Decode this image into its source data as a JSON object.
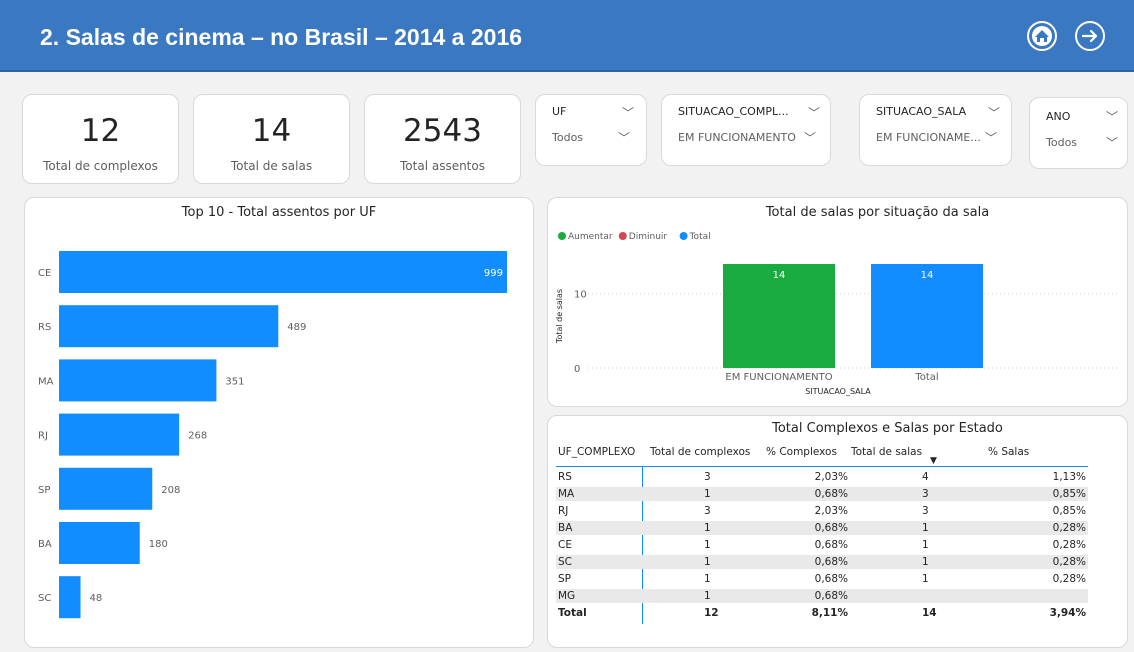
{
  "header": {
    "title": "2. Salas de cinema – no Brasil – 2014 a 2016",
    "home_icon": "home-icon",
    "next_icon": "arrow-right-icon"
  },
  "kpis": [
    {
      "value": "12",
      "label": "Total de complexos"
    },
    {
      "value": "14",
      "label": "Total de salas"
    },
    {
      "value": "2543",
      "label": "Total assentos"
    }
  ],
  "slicers": [
    {
      "title": "UF",
      "value": "Todos"
    },
    {
      "title": "SITUACAO_COMPL...",
      "value": "EM FUNCIONAMENTO"
    },
    {
      "title": "SITUACAO_SALA",
      "value": "EM FUNCIONAME..."
    },
    {
      "title": "ANO",
      "value": "Todos"
    }
  ],
  "colors": {
    "header": "#3b78c2",
    "bar_blue": "#118dff",
    "green": "#1aab40",
    "red": "#d64550"
  },
  "bar_chart": {
    "title": "Top 10 - Total assentos por UF",
    "chart_data": {
      "type": "bar",
      "orientation": "horizontal",
      "categories": [
        "CE",
        "RS",
        "MA",
        "RJ",
        "SP",
        "BA",
        "SC"
      ],
      "values": [
        999,
        489,
        351,
        268,
        208,
        180,
        48
      ],
      "value_labels": [
        "999",
        "489",
        "351",
        "268",
        "208",
        "180",
        "48"
      ],
      "xlim": [
        0,
        999
      ]
    }
  },
  "waterfall": {
    "title": "Total de salas por situação da sala",
    "legend": [
      "Aumentar",
      "Diminuir",
      "Total"
    ],
    "ylabel": "Total de salas",
    "xlabel": "SITUACAO_SALA",
    "y_ticks": [
      "10",
      "0"
    ],
    "chart_data": {
      "type": "bar",
      "categories": [
        "EM FUNCIONAMENTO",
        "Total"
      ],
      "values": [
        14,
        14
      ],
      "value_labels": [
        "14",
        "14"
      ],
      "ylim": [
        0,
        14
      ]
    }
  },
  "table": {
    "title": "Total Complexos e Salas por Estado",
    "columns": [
      "UF_COMPLEXO",
      "Total de complexos",
      "% Complexos",
      "Total de salas",
      "% Salas"
    ],
    "rows": [
      [
        "RS",
        "3",
        "2,03%",
        "4",
        "1,13%"
      ],
      [
        "MA",
        "1",
        "0,68%",
        "3",
        "0,85%"
      ],
      [
        "RJ",
        "3",
        "2,03%",
        "3",
        "0,85%"
      ],
      [
        "BA",
        "1",
        "0,68%",
        "1",
        "0,28%"
      ],
      [
        "CE",
        "1",
        "0,68%",
        "1",
        "0,28%"
      ],
      [
        "SC",
        "1",
        "0,68%",
        "1",
        "0,28%"
      ],
      [
        "SP",
        "1",
        "0,68%",
        "1",
        "0,28%"
      ],
      [
        "MG",
        "1",
        "0,68%",
        "",
        ""
      ]
    ],
    "total": [
      "Total",
      "12",
      "8,11%",
      "14",
      "3,94%"
    ]
  }
}
